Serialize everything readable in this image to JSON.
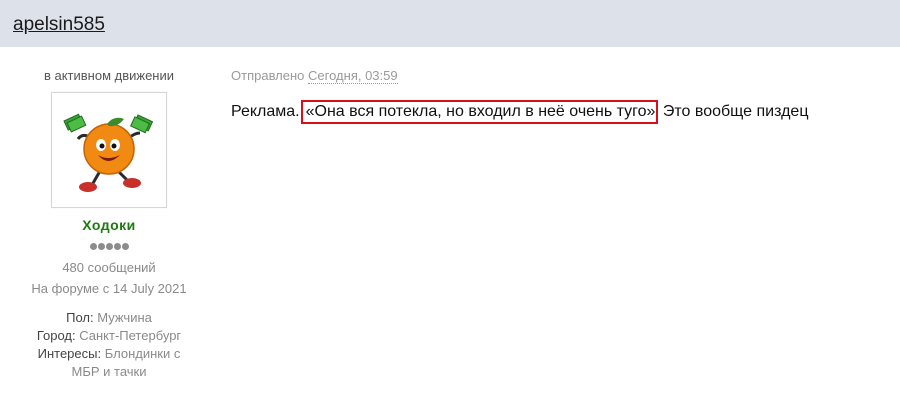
{
  "header": {
    "username": "apelsin585"
  },
  "sidebar": {
    "status": "в активном движении",
    "avatar_icon": "orange-mascot-with-money",
    "group": "Ходоки",
    "group_color": "#1d7a12",
    "rank_pips": 5,
    "post_count": "480 сообщений",
    "joined": "На форуме с 14 July 2021",
    "fields": [
      {
        "label": "Пол:",
        "value": "Мужчина"
      },
      {
        "label": "Город:",
        "value": "Санкт-Петербург"
      },
      {
        "label": "Интересы:",
        "value": "Блондинки с МБР и тачки"
      }
    ]
  },
  "post": {
    "meta_prefix": "Отправлено",
    "date": "Сегодня, 03:59",
    "text_before": "Реклама.",
    "highlighted": "«Она вся потекла, но входил в неё очень туго»",
    "text_after": "Это вообще пиздец",
    "highlight_color": "#d6101a"
  }
}
